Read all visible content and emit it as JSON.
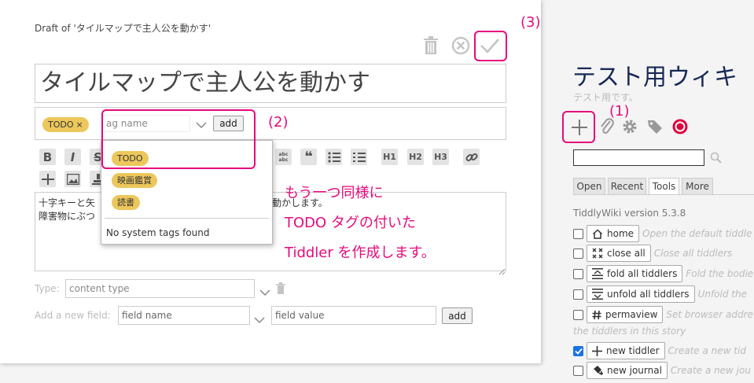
{
  "editor": {
    "draft_title": "Draft of 'タイルマップで主人公を動かす'",
    "title_value": "タイルマップで主人公を動かす",
    "tag": {
      "label": "TODO",
      "remove_glyph": "×"
    },
    "tag_input_value": "ag name",
    "tag_add_label": "add",
    "toolbar_row1": [
      "B",
      "I",
      "S"
    ],
    "toolbar_row1_right": [
      "H1",
      "H2",
      "H3"
    ],
    "text_line1_start": "十字キーと矢",
    "text_line1_end": "動かします。",
    "text_line2_start": "障害物にぶつ",
    "dropdown": {
      "items": [
        "TODO",
        "映画鑑賞",
        "読書"
      ],
      "no_system_tags": "No system tags found"
    },
    "type_label": "Type:",
    "type_placeholder": "content type",
    "new_field_label": "Add a new field:",
    "field_name_placeholder": "field name",
    "field_value_placeholder": "field value",
    "field_add_label": "add"
  },
  "annotations": {
    "step1": "(1)",
    "step2": "(2)",
    "step3": "(3)",
    "line1": "もう一つ同様に",
    "line2": "TODO タグの付いた",
    "line3": "Tiddler を作成します。"
  },
  "sidebar": {
    "site_title": "テスト用ウィキ",
    "site_subtitle": "テスト用です。",
    "tabs": [
      "Open",
      "Recent",
      "Tools",
      "More"
    ],
    "active_tab": "Tools",
    "version": "TiddlyWiki version 5.3.8",
    "tools": [
      {
        "label": "home",
        "desc": "Open the default tiddle",
        "checked": false,
        "icon": "home-icon"
      },
      {
        "label": "close all",
        "desc": "Close all tiddlers",
        "checked": false,
        "icon": "close-all-icon"
      },
      {
        "label": "fold all tiddlers",
        "desc": "Fold the bodie",
        "checked": false,
        "icon": "fold-icon"
      },
      {
        "label": "unfold all tiddlers",
        "desc": "Unfold the",
        "checked": false,
        "icon": "unfold-icon"
      },
      {
        "label": "permaview",
        "desc": "Set browser addre",
        "desc2": "the tiddlers in this story",
        "checked": false,
        "icon": "permaview-icon"
      },
      {
        "label": "new tiddler",
        "desc": "Create a new tid",
        "checked": true,
        "icon": "plus-icon"
      },
      {
        "label": "new journal",
        "desc": "Create a new jou",
        "checked": false,
        "icon": "journal-icon"
      }
    ]
  },
  "colors": {
    "accent": "#e60a7c",
    "tag": "#ecc75b",
    "site_title": "#182955"
  }
}
